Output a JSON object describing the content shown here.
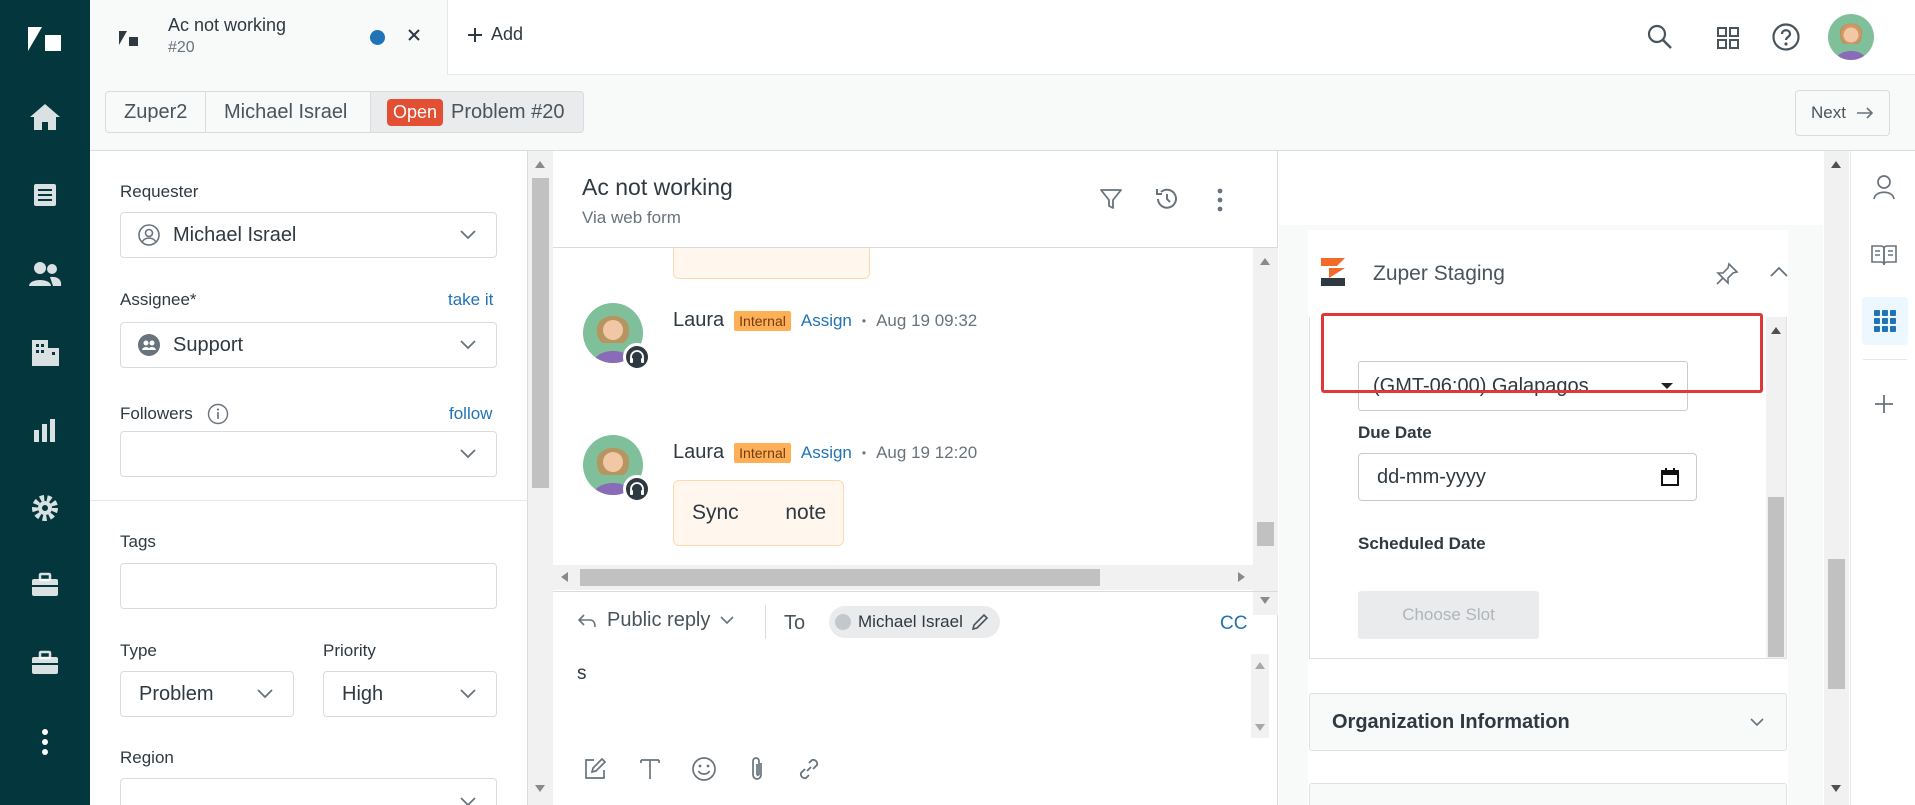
{
  "tab": {
    "title": "Ac not working",
    "subtitle": "#20",
    "add_label": "Add"
  },
  "breadcrumb": {
    "org": "Zuper2",
    "requester": "Michael Israel",
    "status": "Open",
    "ticket": "Problem #20",
    "next": "Next"
  },
  "left": {
    "requester_label": "Requester",
    "requester_value": "Michael Israel",
    "assignee_label": "Assignee*",
    "take_it": "take it",
    "assignee_value": "Support",
    "followers_label": "Followers",
    "follow": "follow",
    "tags_label": "Tags",
    "type_label": "Type",
    "type_value": "Problem",
    "priority_label": "Priority",
    "priority_value": "High",
    "region_label": "Region"
  },
  "conversation": {
    "title": "Ac not working",
    "via": "Via web form",
    "messages": [
      {
        "author": "Laura",
        "badge": "Internal",
        "assign": "Assign",
        "dot": "•",
        "time": "Aug 19 09:32"
      },
      {
        "author": "Laura",
        "badge": "Internal",
        "assign": "Assign",
        "dot": "•",
        "time": "Aug 19 12:20",
        "note": "Sync        note"
      }
    ]
  },
  "composer": {
    "mode": "Public reply",
    "to_label": "To",
    "recipient": "Michael Israel",
    "cc": "CC",
    "body": "s"
  },
  "app": {
    "name": "Zuper Staging",
    "timezone": "(GMT-06:00) Galapagos",
    "due_label": "Due Date",
    "due_placeholder": "dd-mm-yyyy",
    "scheduled_label": "Scheduled Date",
    "choose_slot": "Choose Slot",
    "org_info": "Organization Information"
  },
  "colors": {
    "nav_bg": "#03363d",
    "link": "#1f73b7",
    "open_badge": "#e34f32",
    "highlight": "#e03838",
    "internal_badge": "#ffb057"
  }
}
